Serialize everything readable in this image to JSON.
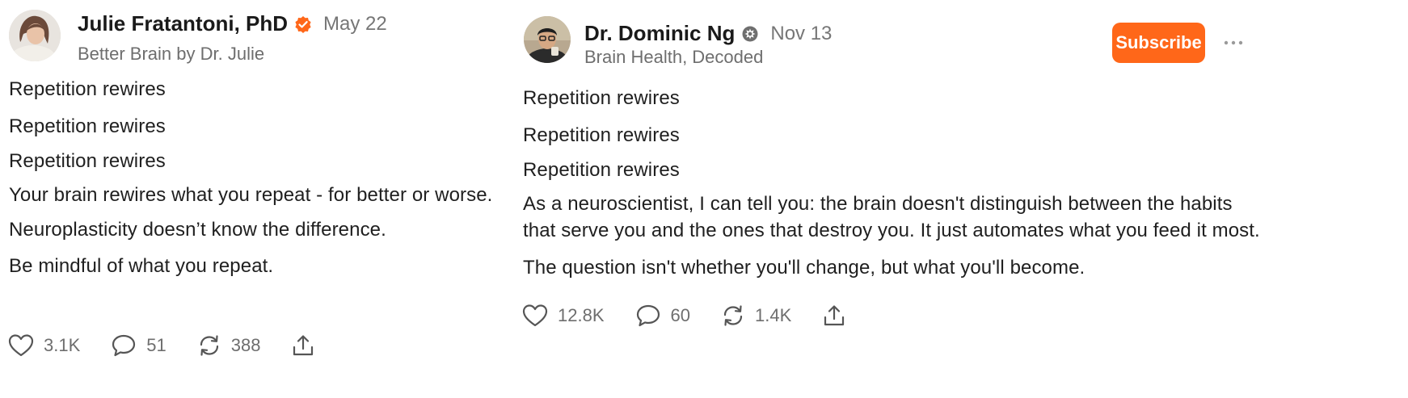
{
  "posts": [
    {
      "author": "Julie Fratantoni, PhD",
      "badge": "verified-check-icon",
      "date": "May 22",
      "publication": "Better Brain by Dr. Julie",
      "lines": [
        "Repetition rewires",
        "Repetition rewires",
        "Repetition rewires",
        "Your brain rewires what you repeat - for better or worse.",
        "Neuroplasticity doesn’t know the difference.",
        "Be mindful of what you repeat."
      ],
      "likes": "3.1K",
      "comments": "51",
      "restacks": "388"
    },
    {
      "author": "Dr. Dominic Ng",
      "badge": "substack-badge-icon",
      "date": "Nov 13",
      "publication": "Brain Health, Decoded",
      "subscribe_label": "Subscribe",
      "lines": [
        "Repetition rewires",
        "Repetition rewires",
        "Repetition rewires",
        "As a neuroscientist, I can tell you: the brain doesn't distinguish between the habits",
        "that serve you and the ones that destroy you. It just automates what you feed it most.",
        "The question isn't whether you'll change, but what you'll become."
      ],
      "likes": "12.8K",
      "comments": "60",
      "restacks": "1.4K"
    }
  ],
  "colors": {
    "accent": "#ff6719",
    "text": "#1f1f1f",
    "muted": "#6e6e6e"
  }
}
